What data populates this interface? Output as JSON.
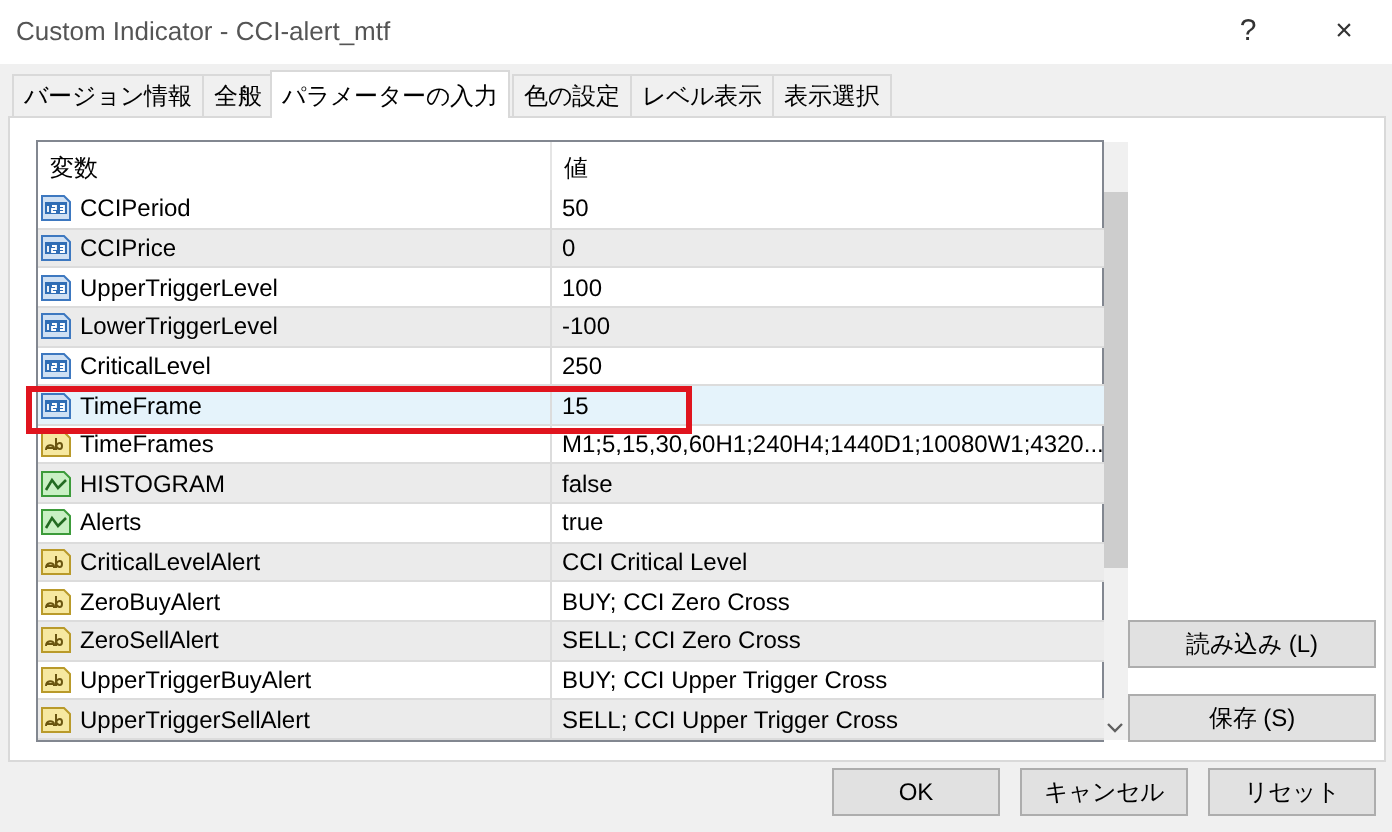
{
  "window": {
    "title": "Custom Indicator - CCI-alert_mtf",
    "help": "?",
    "close": "×"
  },
  "tabs": [
    {
      "label": "バージョン情報",
      "selected": false
    },
    {
      "label": "全般",
      "selected": false
    },
    {
      "label": "パラメーターの入力",
      "selected": true
    },
    {
      "label": "色の設定",
      "selected": false
    },
    {
      "label": "レベル表示",
      "selected": false
    },
    {
      "label": "表示選択",
      "selected": false
    }
  ],
  "table": {
    "columns": [
      "変数",
      "値"
    ],
    "rows": [
      {
        "kind": "number",
        "name": "CCIPeriod",
        "value": "50",
        "selected": false,
        "highlighted": false
      },
      {
        "kind": "number",
        "name": "CCIPrice",
        "value": "0",
        "selected": false,
        "highlighted": false
      },
      {
        "kind": "number",
        "name": "UpperTriggerLevel",
        "value": "100",
        "selected": false,
        "highlighted": false
      },
      {
        "kind": "number",
        "name": "LowerTriggerLevel",
        "value": "-100",
        "selected": false,
        "highlighted": false
      },
      {
        "kind": "number",
        "name": "CriticalLevel",
        "value": "250",
        "selected": false,
        "highlighted": false
      },
      {
        "kind": "number",
        "name": "TimeFrame",
        "value": "15",
        "selected": true,
        "highlighted": true
      },
      {
        "kind": "string",
        "name": "TimeFrames",
        "value": "M1;5,15,30,60H1;240H4;1440D1;10080W1;4320...",
        "selected": false,
        "highlighted": false
      },
      {
        "kind": "bool",
        "name": "HISTOGRAM",
        "value": "false",
        "selected": false,
        "highlighted": false
      },
      {
        "kind": "bool",
        "name": "Alerts",
        "value": "true",
        "selected": false,
        "highlighted": false
      },
      {
        "kind": "string",
        "name": "CriticalLevelAlert",
        "value": "CCI Critical Level",
        "selected": false,
        "highlighted": false
      },
      {
        "kind": "string",
        "name": "ZeroBuyAlert",
        "value": "BUY; CCI Zero Cross",
        "selected": false,
        "highlighted": false
      },
      {
        "kind": "string",
        "name": "ZeroSellAlert",
        "value": "SELL; CCI Zero Cross",
        "selected": false,
        "highlighted": false
      },
      {
        "kind": "string",
        "name": "UpperTriggerBuyAlert",
        "value": "BUY; CCI Upper Trigger Cross",
        "selected": false,
        "highlighted": false
      },
      {
        "kind": "string",
        "name": "UpperTriggerSellAlert",
        "value": "SELL; CCI Upper Trigger Cross",
        "selected": false,
        "highlighted": false
      }
    ]
  },
  "side_buttons": [
    "読み込み (L)",
    "保存 (S)"
  ],
  "buttons": [
    "OK",
    "キャンセル",
    "リセット"
  ]
}
